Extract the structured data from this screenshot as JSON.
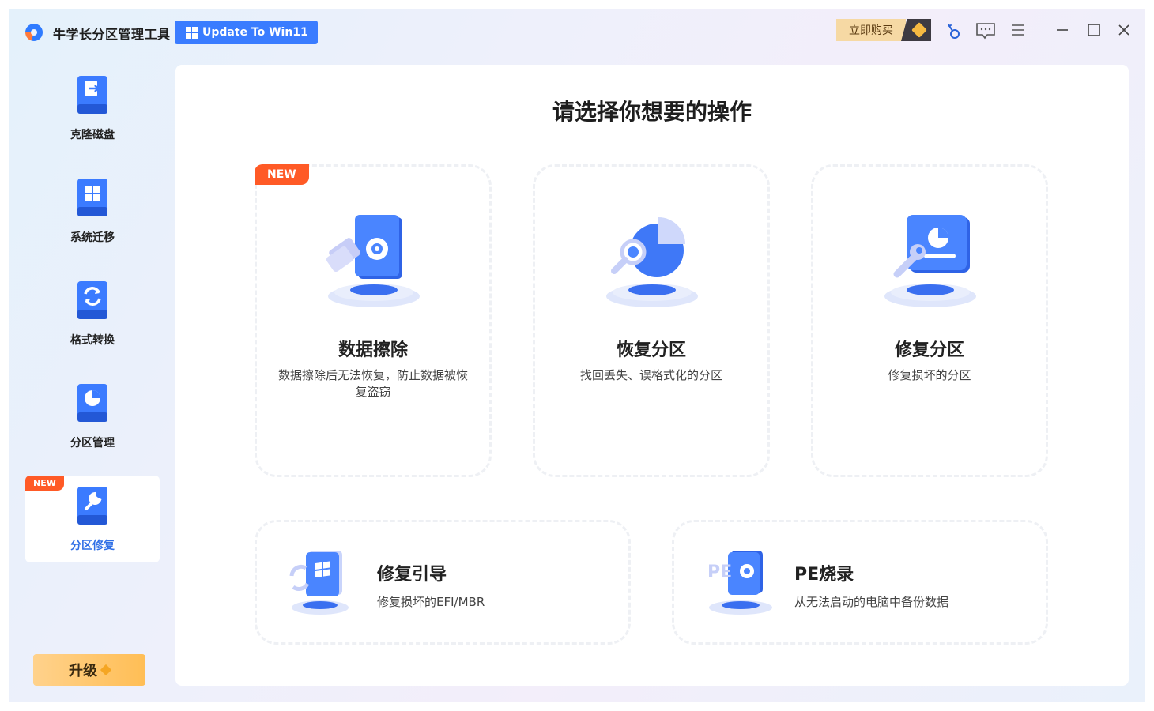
{
  "app": {
    "title": "牛学长分区管理工具",
    "update_button": "Update To Win11",
    "buy_button": "立即购买"
  },
  "titlebar_icons": [
    "key-icon",
    "feedback-icon",
    "menu-icon",
    "minimize-icon",
    "maximize-icon",
    "close-icon"
  ],
  "sidebar": {
    "items": [
      {
        "label": "克隆磁盘",
        "icon": "clone-disk-icon"
      },
      {
        "label": "系统迁移",
        "icon": "system-migrate-icon"
      },
      {
        "label": "格式转换",
        "icon": "format-convert-icon"
      },
      {
        "label": "分区管理",
        "icon": "partition-manage-icon"
      },
      {
        "label": "分区修复",
        "icon": "partition-repair-icon",
        "badge": "NEW",
        "active": true
      }
    ],
    "upgrade_label": "升级"
  },
  "main": {
    "title": "请选择你想要的操作",
    "cards": [
      {
        "title": "数据擦除",
        "desc": "数据擦除后无法恢复，防止数据被恢复盗窃",
        "badge": "NEW",
        "icon": "data-erase-icon"
      },
      {
        "title": "恢复分区",
        "desc": "找回丢失、误格式化的分区",
        "icon": "recover-partition-icon"
      },
      {
        "title": "修复分区",
        "desc": "修复损坏的分区",
        "icon": "repair-partition-icon"
      }
    ],
    "wide_cards": [
      {
        "title": "修复引导",
        "desc": "修复损坏的EFI/MBR",
        "icon": "repair-boot-icon"
      },
      {
        "title": "PE烧录",
        "desc": "从无法启动的电脑中备份数据",
        "icon": "pe-burn-icon"
      }
    ]
  },
  "colors": {
    "accent": "#3a7cff",
    "new_badge": "#ff5a26",
    "upgrade": "#ffc560"
  }
}
